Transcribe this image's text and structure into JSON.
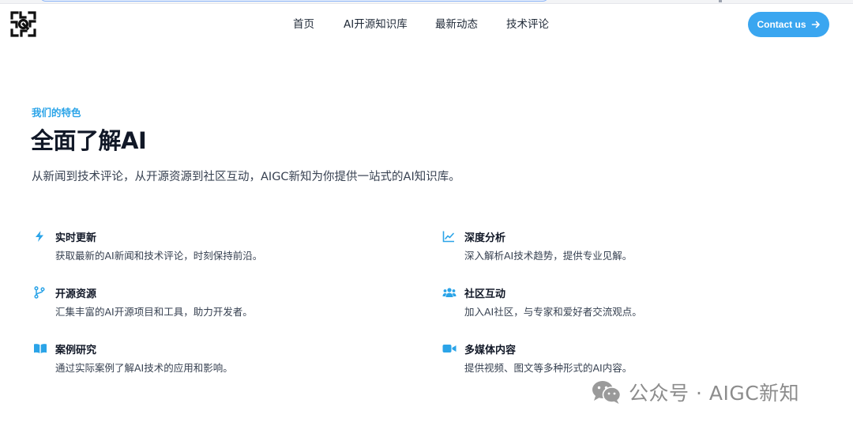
{
  "nav": {
    "items": [
      {
        "label": "首页"
      },
      {
        "label": "AI开源知识库"
      },
      {
        "label": "最新动态"
      },
      {
        "label": "技术评论"
      }
    ],
    "contact_label": "Contact us"
  },
  "hero": {
    "eyebrow": "我们的特色",
    "title": "全面了解AI",
    "subtitle": "从新闻到技术评论，从开源资源到社区互动，AIGC新知为你提供一站式的AI知识库。"
  },
  "features": [
    {
      "icon": "bolt-icon",
      "title": "实时更新",
      "desc": "获取最新的AI新闻和技术评论，时刻保持前沿。"
    },
    {
      "icon": "chart-line-icon",
      "title": "深度分析",
      "desc": "深入解析AI技术趋势，提供专业见解。"
    },
    {
      "icon": "code-branch-icon",
      "title": "开源资源",
      "desc": "汇集丰富的AI开源项目和工具，助力开发者。"
    },
    {
      "icon": "users-icon",
      "title": "社区互动",
      "desc": "加入AI社区，与专家和爱好者交流观点。"
    },
    {
      "icon": "book-open-icon",
      "title": "案例研究",
      "desc": "通过实际案例了解AI技术的应用和影响。"
    },
    {
      "icon": "video-icon",
      "title": "多媒体内容",
      "desc": "提供视频、图文等多种形式的AI内容。"
    }
  ],
  "watermark": {
    "text": "公众号 · AIGC新知"
  },
  "colors": {
    "accent": "#3aa6f0",
    "eyebrow": "#2ba4e8",
    "icon": "#2ba4e8",
    "text": "#111827",
    "muted": "#374151"
  }
}
